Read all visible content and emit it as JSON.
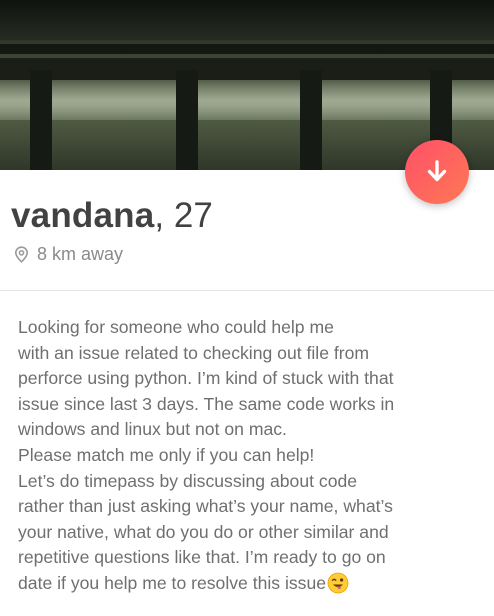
{
  "profile": {
    "name": "vandana",
    "age_text": ", 27",
    "distance": "8 km away"
  },
  "bio": {
    "lines": [
      "Looking for someone who could help me",
      "with an issue related to checking out file from",
      "perforce using python. I’m kind of stuck with that",
      "issue since last 3 days. The same code works in",
      "windows and linux but not on mac.",
      "Please match me only if you can help!",
      "Let’s do timepass by discussing about code",
      "rather than just asking what’s your name, what’s",
      "your native, what do you do or other similar and",
      "repetitive questions like that. I’m ready to go on",
      "date if you help me to resolve this issue"
    ]
  },
  "icons": {
    "expand": "arrow-down-icon",
    "location": "location-pin-icon",
    "emoji": "winking-tongue-emoji-icon"
  },
  "colors": {
    "fab_start": "#fd5068",
    "fab_end": "#ff7854",
    "name_text": "#424242",
    "muted_text": "#8a8a8a"
  }
}
